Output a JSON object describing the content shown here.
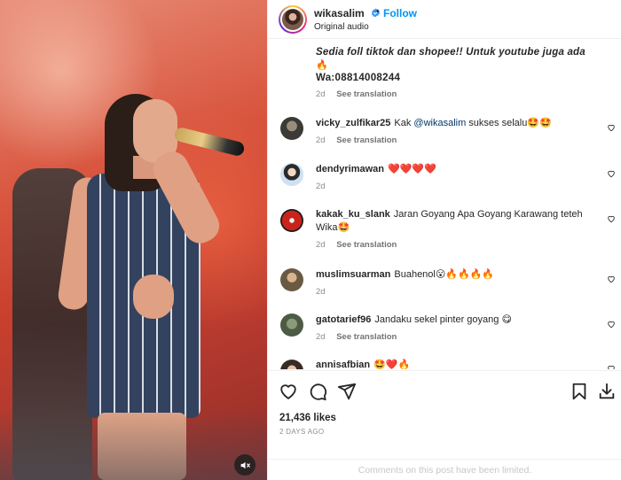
{
  "post": {
    "username": "wikasalim",
    "follow_label": "Follow",
    "dot": "•",
    "audio": "Original audio",
    "caption_line1": "Sedia foll tiktok dan shopee!! Untuk youtube juga ada",
    "caption_emoji": "🔥",
    "caption_line2": "Wa:08814008244",
    "caption_age": "2d",
    "see_translation": "See translation"
  },
  "comments": [
    {
      "user": "vicky_zulfikar25",
      "pre": "Kak ",
      "mention": "@wikasalim",
      "text": " sukses selalu🤩🤩",
      "age": "2d",
      "translation": "See translation"
    },
    {
      "user": "dendyrimawan",
      "text": "❤️❤️❤️❤️",
      "age": "2d"
    },
    {
      "user": "kakak_ku_slank",
      "text": "Jaran Goyang Apa Goyang Karawang teteh Wika🤩",
      "age": "2d",
      "translation": "See translation"
    },
    {
      "user": "muslimsuarman",
      "text": "Buahenol😮🔥🔥🔥🔥",
      "age": "2d"
    },
    {
      "user": "gatotarief96",
      "text": "Jandaku sekel pinter goyang 😋",
      "age": "2d",
      "translation": "See translation"
    },
    {
      "user": "annisafbian",
      "text": "🤩❤️🔥"
    }
  ],
  "actions": {
    "likes": "21,436 likes",
    "date": "2 DAYS AGO",
    "limited": "Comments on this post have been limited."
  },
  "colors": {
    "accent": "#0095f6",
    "muted": "#8e8e8e",
    "mention": "#00376b"
  }
}
